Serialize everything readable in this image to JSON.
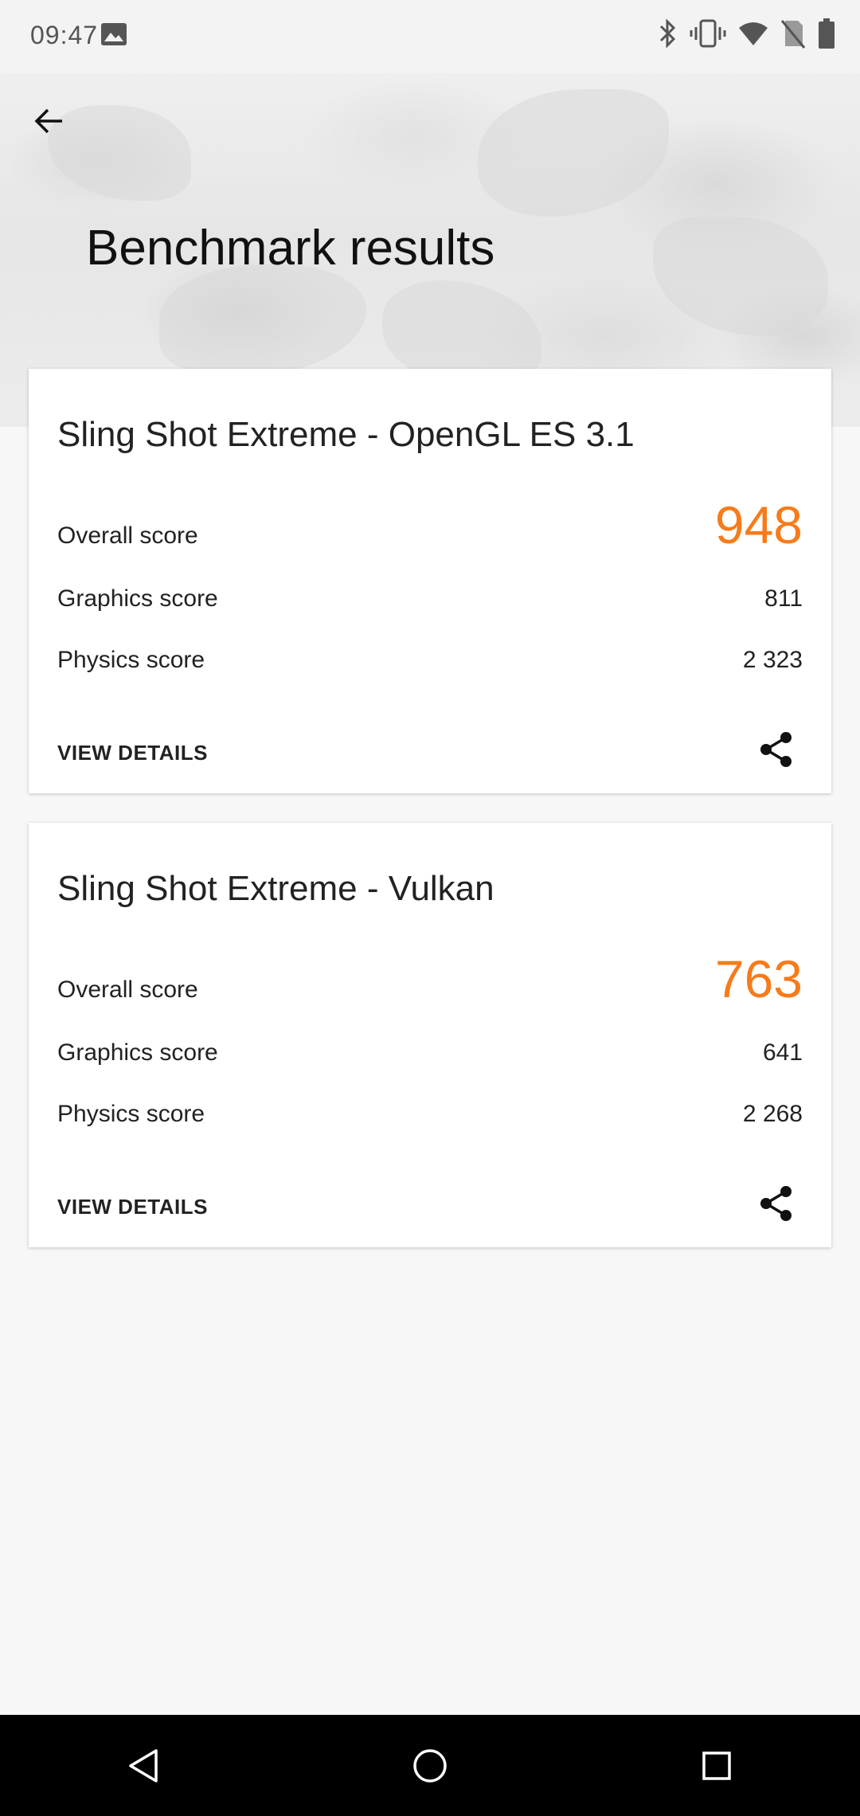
{
  "status_bar": {
    "time": "09:47",
    "icons": [
      "image-icon",
      "bluetooth-icon",
      "vibrate-icon",
      "wifi-icon",
      "no-sim-icon",
      "battery-icon"
    ]
  },
  "header": {
    "title": "Benchmark results",
    "back_icon": "arrow-back-icon"
  },
  "cards": [
    {
      "title": "Sling Shot Extreme - OpenGL ES 3.1",
      "overall_label": "Overall score",
      "overall_value": "948",
      "graphics_label": "Graphics score",
      "graphics_value": "811",
      "physics_label": "Physics score",
      "physics_value": "2 323",
      "view_details": "VIEW DETAILS",
      "share_icon": "share-icon"
    },
    {
      "title": "Sling Shot Extreme - Vulkan",
      "overall_label": "Overall score",
      "overall_value": "763",
      "graphics_label": "Graphics score",
      "graphics_value": "641",
      "physics_label": "Physics score",
      "physics_value": "2 268",
      "view_details": "VIEW DETAILS",
      "share_icon": "share-icon"
    }
  ],
  "nav_bar": {
    "icons": [
      "back-triangle-icon",
      "home-circle-icon",
      "recents-square-icon"
    ]
  },
  "colors": {
    "accent": "#f77b1a",
    "background": "#f7f7f7",
    "card": "#ffffff",
    "nav_bar": "#000000"
  }
}
